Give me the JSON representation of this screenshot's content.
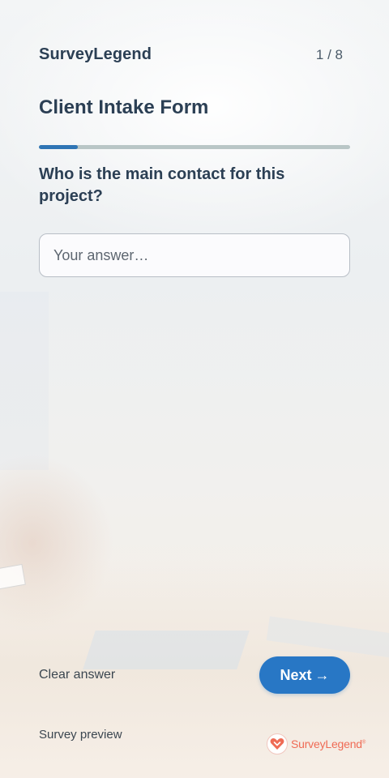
{
  "header": {
    "brand": "SurveyLegend",
    "counter": "1 / 8"
  },
  "form": {
    "title": "Client Intake Form",
    "progress_fraction": 0.125,
    "question": "Who is the main contact for this project?",
    "answer_placeholder": "Your answer…",
    "answer_value": ""
  },
  "footer": {
    "clear_label": "Clear answer",
    "next_label": "Next",
    "next_arrow": "→",
    "preview_label": "Survey preview",
    "logo_text": "SurveyLegend",
    "logo_mark": "®"
  },
  "colors": {
    "accent": "#2877c5",
    "progress_fill": "#2f75b5",
    "progress_track": "#b9c6c6",
    "logo": "#ef6b55",
    "heading": "#2b3f54"
  },
  "icons": {
    "logo": "surveylegend-heart-icon",
    "arrow": "arrow-right-icon"
  }
}
